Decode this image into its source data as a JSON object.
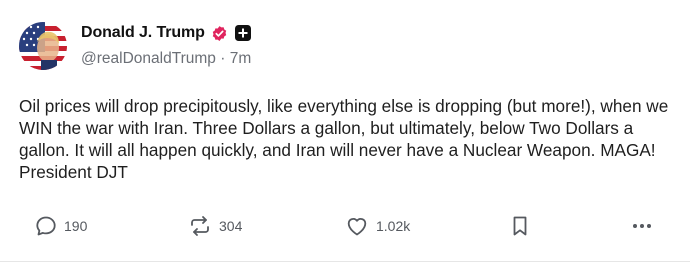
{
  "post": {
    "display_name": "Donald J. Trump",
    "handle": "@realDonaldTrump",
    "separator": "·",
    "time_ago": "7m",
    "text": "Oil prices will drop precipitously, like everything else is dropping (but more!), when we WIN the war with Iran. Three Dollars a gallon, but ultimately, below Two Dollars a gallon. It will all happen quickly, and Iran will never have a Nuclear Weapon. MAGA! President DJT"
  },
  "actions": {
    "replies": "190",
    "reposts": "304",
    "likes": "1.02k"
  },
  "icons": {
    "avatar": "flag-portrait-avatar",
    "verified": "verified-badge-icon",
    "plus": "plus-badge-icon",
    "reply": "speech-bubble-icon",
    "repost": "repost-arrows-icon",
    "like": "heart-icon",
    "bookmark": "bookmark-icon",
    "more": "more-dots-icon"
  },
  "colors": {
    "verified_badge": "#e0245e",
    "text": "#1f1f1f",
    "muted": "#6b6f76"
  }
}
